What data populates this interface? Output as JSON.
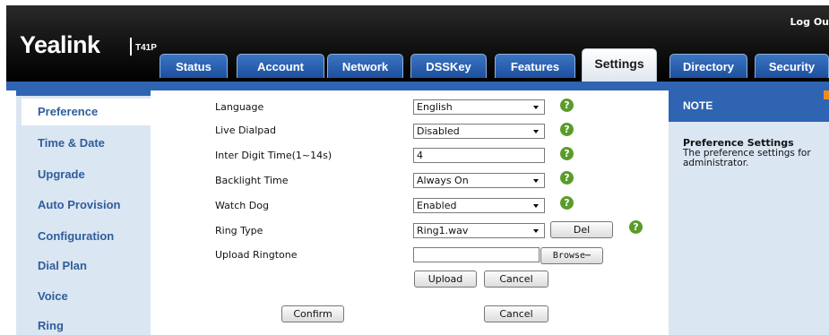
{
  "header": {
    "logout": "Log Ou",
    "brand": "Yealink",
    "model": "T41P"
  },
  "tabs": [
    "Status",
    "Account",
    "Network",
    "DSSKey",
    "Features",
    "Settings",
    "Directory",
    "Security"
  ],
  "active_tab": "Settings",
  "sidebar": {
    "items": [
      "Preference",
      "Time & Date",
      "Upgrade",
      "Auto Provision",
      "Configuration",
      "Dial Plan",
      "Voice",
      "Ring"
    ],
    "active": "Preference"
  },
  "form": {
    "language": {
      "label": "Language",
      "value": "English"
    },
    "live_dialpad": {
      "label": "Live Dialpad",
      "value": "Disabled"
    },
    "inter_digit": {
      "label": "Inter Digit Time(1~14s)",
      "value": "4"
    },
    "backlight": {
      "label": "Backlight Time",
      "value": "Always On"
    },
    "watch_dog": {
      "label": "Watch Dog",
      "value": "Enabled"
    },
    "ring_type": {
      "label": "Ring Type",
      "value": "Ring1.wav"
    },
    "upload_ringtone": {
      "label": "Upload Ringtone",
      "value": ""
    },
    "del_label": "Del",
    "browse_label": "Browse⋯",
    "upload_label": "Upload",
    "upload_cancel_label": "Cancel",
    "confirm_label": "Confirm",
    "cancel_label": "Cancel",
    "help_glyph": "?"
  },
  "note": {
    "header": "NOTE",
    "title": "Preference Settings",
    "text": "The preference settings for administrator."
  },
  "colors": {
    "brand_blue": "#2e64b2",
    "sidebar_bg": "#dbe6f3",
    "help_green": "#5a9c2a",
    "accent_orange": "#f08c1e"
  }
}
